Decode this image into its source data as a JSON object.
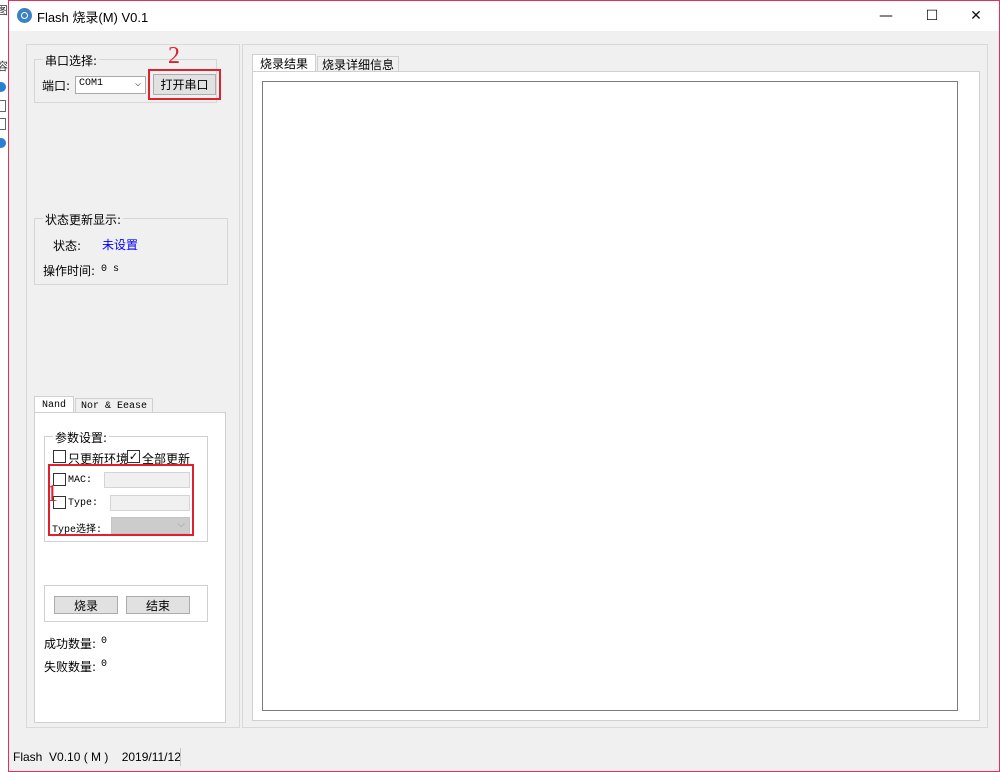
{
  "window": {
    "title": "Flash 烧录(M)  V0.1",
    "minimize_glyph": "—",
    "maximize_glyph": "☐",
    "close_glyph": "✕"
  },
  "desktop_glyphs": [
    "图",
    "容"
  ],
  "serial": {
    "group_title": "串口选择:",
    "port_label": "端口:",
    "port_value": "COM1",
    "open_button": "打开串口"
  },
  "status": {
    "group_title": "状态更新显示:",
    "state_label": "状态:",
    "state_value": "未设置",
    "time_label": "操作时间:",
    "time_value": "0 s"
  },
  "left_tabs": [
    "Nand",
    "Nor & Eease"
  ],
  "params": {
    "group_title": "参数设置:",
    "only_env_label": "只更新环境",
    "only_env_checked": false,
    "all_update_label": "全部更新",
    "all_update_checked": true,
    "mac_label": "MAC:",
    "mac_checked": false,
    "mac_value": "",
    "type_label": "Type:",
    "type_checked": false,
    "type_value": "",
    "type_select_label": "Type选择:",
    "type_select_value": ""
  },
  "actions": {
    "burn_button": "烧录",
    "end_button": "结束"
  },
  "counts": {
    "success_label": "成功数量:",
    "success_value": "0",
    "fail_label": "失败数量:",
    "fail_value": "0"
  },
  "right_tabs": [
    "烧录结果",
    "烧录详细信息"
  ],
  "annotations": {
    "one": "1",
    "two": "2"
  },
  "statusbar": {
    "text": "Flash  V0.10 ( M )    2019/11/12"
  },
  "colors": {
    "annotation": "#e0202a",
    "status_value": "#0000ff",
    "window_border": "#e2315a"
  },
  "icons": [
    "app-icon",
    "chevron-down-icon",
    "check-icon",
    "minimize-icon",
    "maximize-icon",
    "close-icon"
  ]
}
